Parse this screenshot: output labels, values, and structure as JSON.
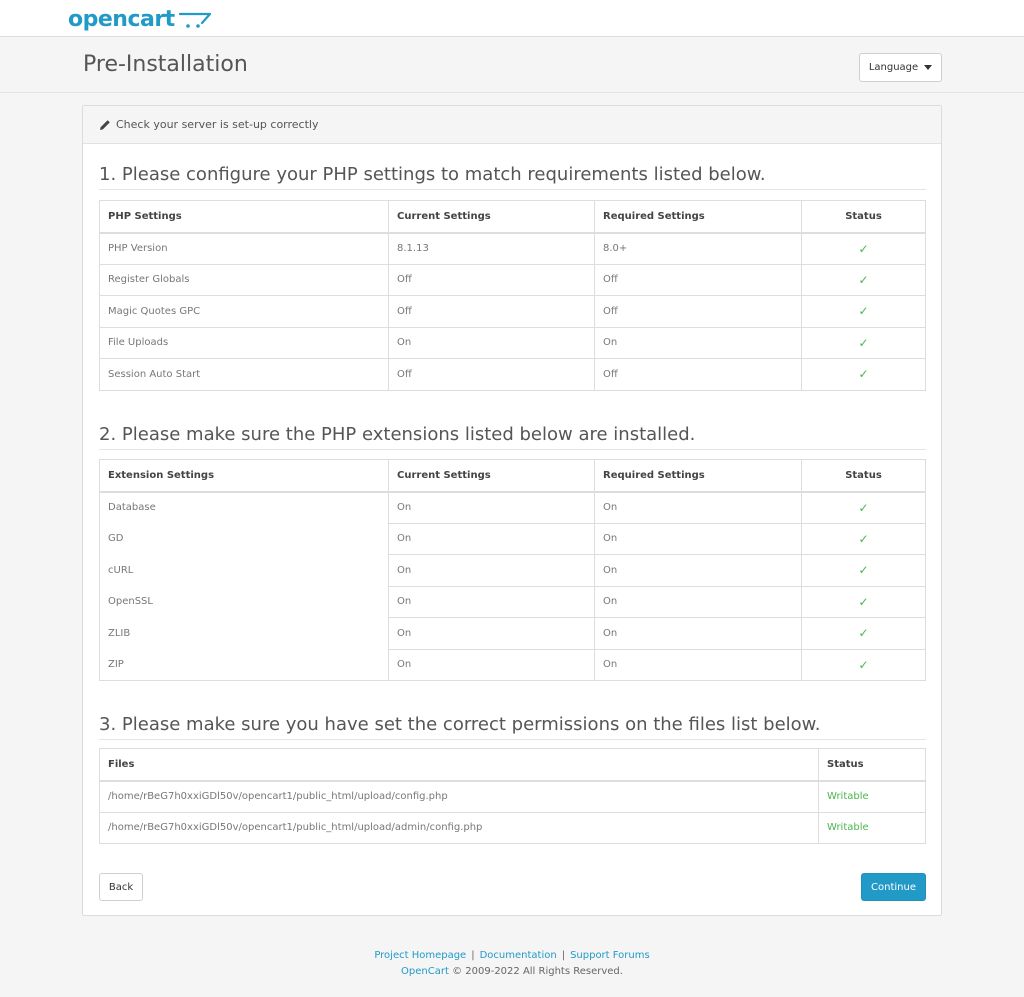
{
  "brand": {
    "logo_text": "opencart"
  },
  "header": {
    "title": "Pre-Installation",
    "language_label": "Language"
  },
  "panel": {
    "heading": "Check your server is set-up correctly"
  },
  "section1": {
    "title": "1. Please configure your PHP settings to match requirements listed below.",
    "columns": [
      "PHP Settings",
      "Current Settings",
      "Required Settings",
      "Status"
    ],
    "rows": [
      [
        "PHP Version",
        "8.1.13",
        "8.0+",
        "✓"
      ],
      [
        "Register Globals",
        "Off",
        "Off",
        "✓"
      ],
      [
        "Magic Quotes GPC",
        "Off",
        "Off",
        "✓"
      ],
      [
        "File Uploads",
        "On",
        "On",
        "✓"
      ],
      [
        "Session Auto Start",
        "Off",
        "Off",
        "✓"
      ]
    ]
  },
  "section2": {
    "title": "2. Please make sure the PHP extensions listed below are installed.",
    "columns": [
      "Extension Settings",
      "Current Settings",
      "Required Settings",
      "Status"
    ],
    "rows": [
      [
        "Database",
        "On",
        "On",
        "✓"
      ],
      [
        "GD",
        "On",
        "On",
        "✓"
      ],
      [
        "cURL",
        "On",
        "On",
        "✓"
      ],
      [
        "OpenSSL",
        "On",
        "On",
        "✓"
      ],
      [
        "ZLIB",
        "On",
        "On",
        "✓"
      ],
      [
        "ZIP",
        "On",
        "On",
        "✓"
      ]
    ]
  },
  "section3": {
    "title": "3. Please make sure you have set the correct permissions on the files list below.",
    "columns": [
      "Files",
      "Status"
    ],
    "rows": [
      [
        "/home/rBeG7h0xxiGDl50v/opencart1/public_html/upload/config.php",
        "Writable"
      ],
      [
        "/home/rBeG7h0xxiGDl50v/opencart1/public_html/upload/admin/config.php",
        "Writable"
      ]
    ]
  },
  "buttons": {
    "back": "Back",
    "continue": "Continue"
  },
  "footer": {
    "link_homepage": "Project Homepage",
    "link_docs": "Documentation",
    "link_forums": "Support Forums",
    "sep": "|",
    "brand_link": "OpenCart",
    "copyright": "© 2009-2022 All Rights Reserved."
  },
  "colors": {
    "accent": "#229ac8",
    "success": "#4cb64c"
  },
  "icons": {
    "heading_icon": "pencil-icon",
    "status_icon": "check-icon",
    "dropdown_icon": "caret-down-icon",
    "logo_icon": "cart-icon"
  }
}
